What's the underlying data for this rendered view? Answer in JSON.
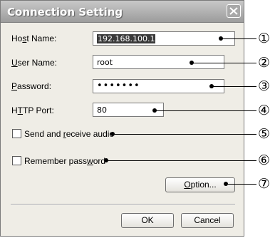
{
  "window": {
    "title": "Connection Setting"
  },
  "fields": {
    "host_name": {
      "label": "Host Name:",
      "value": "192.168.100.1"
    },
    "user_name": {
      "label": "User Name:",
      "value": "root"
    },
    "password": {
      "label": "Password:",
      "value": "•••••••"
    },
    "http_port": {
      "label": "HTTP Port:",
      "value": "80"
    }
  },
  "checkboxes": {
    "send_receive_audio": {
      "label": "Send and receive audio",
      "checked": false
    },
    "remember_password": {
      "label": "Remember password",
      "checked": false
    }
  },
  "buttons": {
    "option": "Option...",
    "ok": "OK",
    "cancel": "Cancel"
  },
  "callouts": [
    "①",
    "②",
    "③",
    "④",
    "⑤",
    "⑥",
    "⑦"
  ],
  "icons": {
    "close": "close-icon"
  }
}
